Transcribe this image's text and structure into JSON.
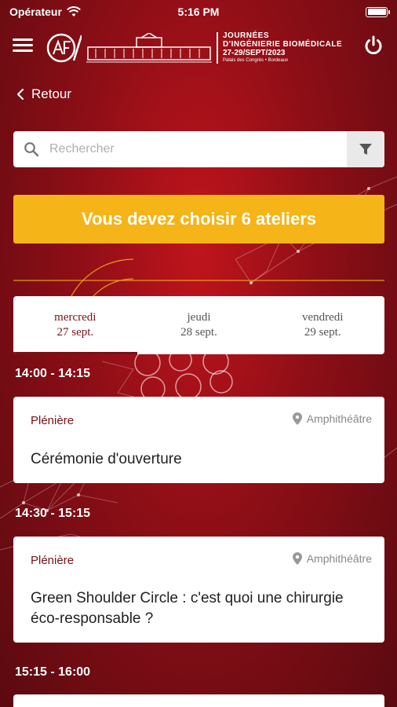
{
  "status_bar": {
    "carrier": "Opérateur",
    "time": "5:16 PM"
  },
  "header": {
    "logo_line1": "JOURNÉES",
    "logo_line2": "D'INGÉNIERIE BIOMÉDICALE",
    "logo_line3": "27-29/SEPT/2023",
    "logo_line4": "Palais des Congrès • Bordeaux"
  },
  "nav": {
    "back_label": "Retour"
  },
  "search": {
    "placeholder": "Rechercher"
  },
  "banner": {
    "text": "Vous devez choisir 6 ateliers"
  },
  "days": [
    {
      "weekday": "mercredi",
      "date": "27 sept.",
      "active": true
    },
    {
      "weekday": "jeudi",
      "date": "28 sept.",
      "active": false
    },
    {
      "weekday": "vendredi",
      "date": "29 sept.",
      "active": false
    }
  ],
  "schedule": [
    {
      "time": "14:00 - 14:15",
      "type": "Plénière",
      "location": "Amphithéâtre",
      "title": "Cérémonie d'ouverture"
    },
    {
      "time": "14:30 - 15:15",
      "type": "Plénière",
      "location": "Amphithéâtre",
      "title": "Green Shoulder Circle : c'est quoi une chirurgie éco-responsable ?"
    },
    {
      "time": "15:15 - 16:00"
    }
  ],
  "colors": {
    "background": "#8c0e16",
    "accent": "#7a1016",
    "banner": "#f5b417"
  }
}
